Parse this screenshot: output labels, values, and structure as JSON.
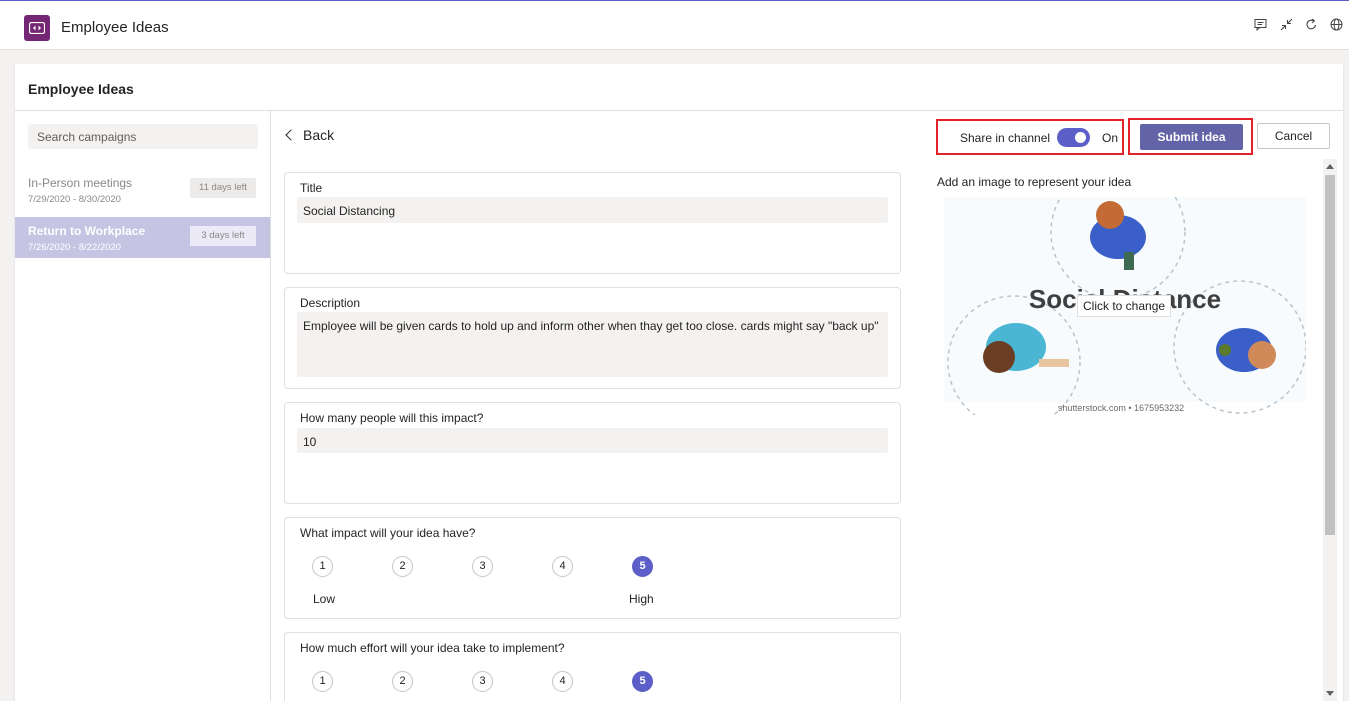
{
  "app": {
    "title": "Employee Ideas",
    "header_icons": [
      "chat-icon",
      "collapse-icon",
      "refresh-icon",
      "globe-icon"
    ]
  },
  "card": {
    "title": "Employee Ideas"
  },
  "sidebar": {
    "search_placeholder": "Search campaigns",
    "campaigns": [
      {
        "name": "In-Person meetings",
        "dates": "7/29/2020 - 8/30/2020",
        "badge": "11 days left",
        "active": false
      },
      {
        "name": "Return to Workplace",
        "dates": "7/26/2020 - 8/22/2020",
        "badge": "3 days left",
        "active": true
      }
    ]
  },
  "form": {
    "back_label": "Back",
    "title_field": {
      "label": "Title",
      "value": "Social Distancing"
    },
    "description_field": {
      "label": "Description",
      "value": "Employee will be given cards to hold up and inform other when thay get too close. cards might say \"back up\""
    },
    "people_field": {
      "label": "How many people will this impact?",
      "value": "10"
    },
    "impact_field": {
      "label": "What impact will your idea have?",
      "options": [
        "1",
        "2",
        "3",
        "4",
        "5"
      ],
      "selected": "5",
      "low_label": "Low",
      "high_label": "High"
    },
    "effort_field": {
      "label": "How much effort will your idea take to implement?",
      "options": [
        "1",
        "2",
        "3",
        "4",
        "5"
      ],
      "selected": "5"
    }
  },
  "actions": {
    "share_label": "Share in channel",
    "share_state": "On",
    "submit_label": "Submit idea",
    "cancel_label": "Cancel"
  },
  "image_panel": {
    "label": "Add an image to represent your idea",
    "image_text": "Social Distance",
    "watermark": "shutterstock.com • 1675953232",
    "tooltip": "Click to change"
  },
  "colors": {
    "accent": "#5b5fc7",
    "submit": "#6264a7",
    "highlight_box": "#e3212b",
    "active_campaign": "#c5c4e3",
    "app_icon": "#742774"
  }
}
